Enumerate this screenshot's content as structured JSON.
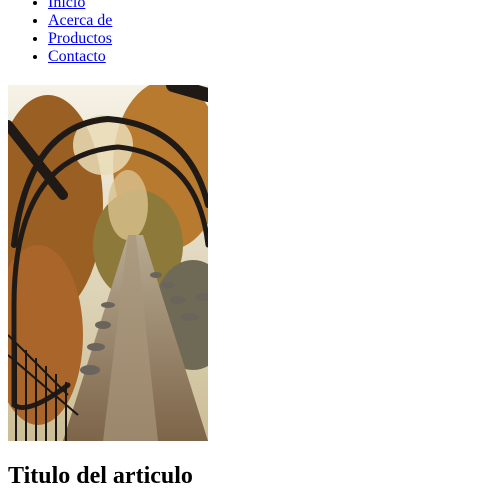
{
  "nav": {
    "items": [
      {
        "label": "Inicio"
      },
      {
        "label": "Acerca de"
      },
      {
        "label": "Productos"
      },
      {
        "label": "Contacto"
      }
    ],
    "link_color": "#0000ee"
  },
  "hero": {
    "subject": "autumn path under an arched metal arbor",
    "colors": {
      "foliage": "#c8842e",
      "path": "#9c8a72",
      "arch": "#1f1a16",
      "sky": "#f3efe2"
    }
  },
  "article": {
    "title": "Titulo del articulo"
  }
}
